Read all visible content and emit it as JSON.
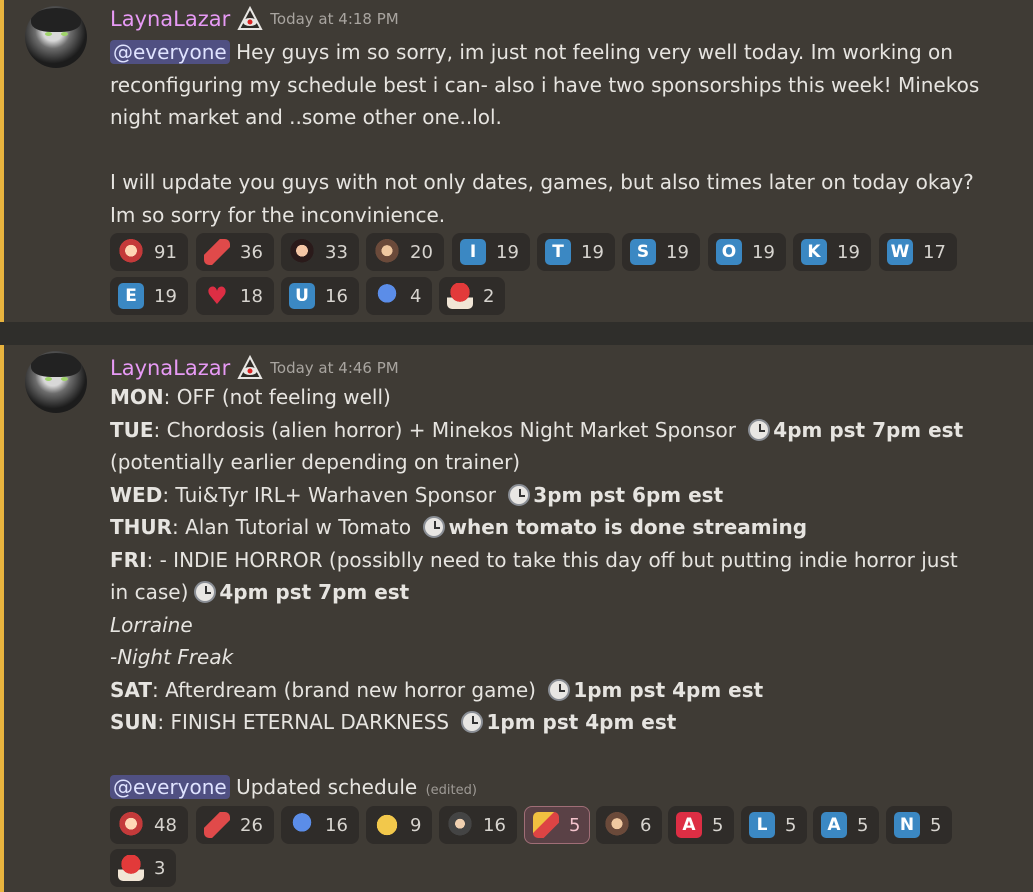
{
  "messages": [
    {
      "username": "LaynaLazar",
      "timestamp": "Today at 4:18 PM",
      "mention": "@everyone",
      "lines": [
        "Hey guys im so sorry, im just not feeling very well today. Im working on",
        "reconfiguring my schedule best i can- also i have two sponsorships this week! Minekos",
        "night market and ..some other one..lol.",
        "I will update you guys with not only dates, games, but also times later on today okay?",
        "Im so sorry for the inconvinience."
      ],
      "reactions": [
        {
          "emoji": "red-hair-face",
          "count": "91"
        },
        {
          "emoji": "thumbs-up-red",
          "count": "36"
        },
        {
          "emoji": "dark-hair-face",
          "count": "33"
        },
        {
          "emoji": "brown-hair-face",
          "count": "20"
        },
        {
          "emoji": "letter-i",
          "letter": "I",
          "count": "19"
        },
        {
          "emoji": "letter-t",
          "letter": "T",
          "count": "19"
        },
        {
          "emoji": "letter-s",
          "letter": "S",
          "count": "19"
        },
        {
          "emoji": "letter-o",
          "letter": "O",
          "count": "19"
        },
        {
          "emoji": "letter-k",
          "letter": "K",
          "count": "19"
        },
        {
          "emoji": "letter-w",
          "letter": "W",
          "count": "17"
        },
        {
          "emoji": "letter-e",
          "letter": "E",
          "count": "19"
        },
        {
          "emoji": "red-heart",
          "letter": "♥",
          "count": "18"
        },
        {
          "emoji": "letter-u",
          "letter": "U",
          "count": "16"
        },
        {
          "emoji": "pixel-character",
          "count": "4"
        },
        {
          "emoji": "mushroom",
          "count": "2"
        }
      ]
    },
    {
      "username": "LaynaLazar",
      "timestamp": "Today at 4:46 PM",
      "schedule": {
        "mon_day": "MON",
        "mon_text": ": OFF (not feeling well)",
        "tue_day": "TUE",
        "tue_text": ": Chordosis (alien horror) + Minekos Night Market Sponsor ",
        "tue_time": "4pm pst 7pm est",
        "tue_cont": "(potentially earlier depending on trainer)",
        "wed_day": "WED",
        "wed_text": ": Tui&Tyr IRL+ Warhaven Sponsor ",
        "wed_time": "3pm pst 6pm est",
        "thur_day": "THUR",
        "thur_text": ": Alan Tutorial w Tomato ",
        "thur_time": "when tomato is done streaming",
        "fri_day": "FRI",
        "fri_text": ": - INDIE HORROR (possiblly need to take this day off but putting indie horror just",
        "fri_cont": "in case)",
        "fri_time": "4pm pst 7pm est",
        "extra1": "Lorraine",
        "extra2": "-Night Freak",
        "sat_day": "SAT",
        "sat_text": ": Afterdream (brand new horror game) ",
        "sat_time": "1pm pst 4pm est",
        "sun_day": "SUN",
        "sun_text": ": FINISH ETERNAL DARKNESS ",
        "sun_time": "1pm pst 4pm est"
      },
      "mention": "@everyone",
      "footer_text": "Updated schedule",
      "edited_label": "(edited)",
      "reactions": [
        {
          "emoji": "red-hair-face",
          "count": "48"
        },
        {
          "emoji": "thumbs-up-red",
          "count": "26"
        },
        {
          "emoji": "hugging-person",
          "count": "16"
        },
        {
          "emoji": "smiling-hearts-face",
          "count": "9"
        },
        {
          "emoji": "dark-hair-face",
          "count": "16"
        },
        {
          "emoji": "flexed-arm",
          "count": "5",
          "selected": true
        },
        {
          "emoji": "hands-face",
          "count": "6"
        },
        {
          "emoji": "letter-a",
          "letter": "A",
          "count": "5"
        },
        {
          "emoji": "letter-l",
          "letter": "L",
          "count": "5"
        },
        {
          "emoji": "letter-a-blue",
          "letter": "A",
          "count": "5"
        },
        {
          "emoji": "letter-n",
          "letter": "N",
          "count": "5"
        },
        {
          "emoji": "mushroom",
          "count": "3"
        }
      ]
    }
  ],
  "colors": {
    "username": "#e79af5",
    "accent_bar": "#e8b33e",
    "mention_bg": "#505082"
  }
}
